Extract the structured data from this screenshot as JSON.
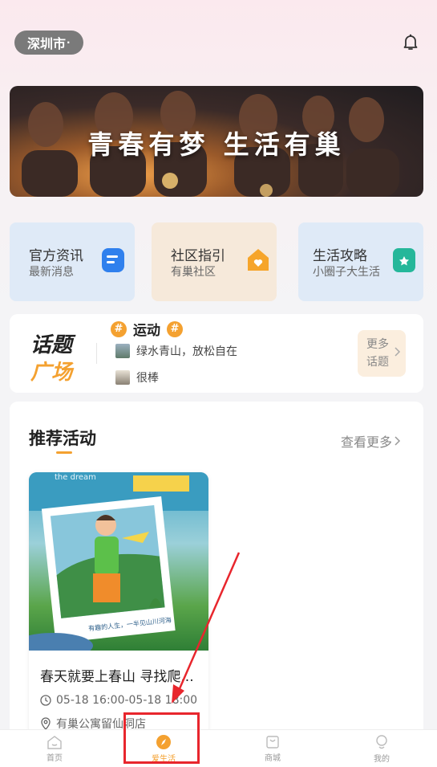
{
  "header": {
    "city": "深圳市",
    "city_suffix": "·"
  },
  "banner": {
    "text": "青春有梦  生活有巢"
  },
  "quick_cards": [
    {
      "title": "官方资讯",
      "subtitle": "最新消息"
    },
    {
      "title": "社区指引",
      "subtitle": "有巢社区"
    },
    {
      "title": "生活攻略",
      "subtitle": "小圈子大生活"
    }
  ],
  "topic": {
    "logo_line1": "话题",
    "logo_line2": "广场",
    "title": "运动",
    "items": [
      "绿水青山，放松自在",
      "很棒"
    ],
    "more_line1": "更多",
    "more_line2": "话题"
  },
  "recommend": {
    "title": "推荐活动",
    "more": "查看更多",
    "card": {
      "image_text_top": "the dream",
      "image_caption": "有趣的人生，一半见山川河海",
      "title": "春天就要上春山 寻找爬...",
      "time": "05-18 16:00-05-18 18:00",
      "location": "有巢公寓留仙洞店"
    }
  },
  "tabs": [
    {
      "label": "首页",
      "active": false
    },
    {
      "label": "爱生活",
      "active": true
    },
    {
      "label": "商城",
      "active": false
    },
    {
      "label": "我的",
      "active": false
    }
  ],
  "colors": {
    "accent": "#f4a130",
    "annotation": "#e8262d",
    "primary_text": "#222222"
  }
}
